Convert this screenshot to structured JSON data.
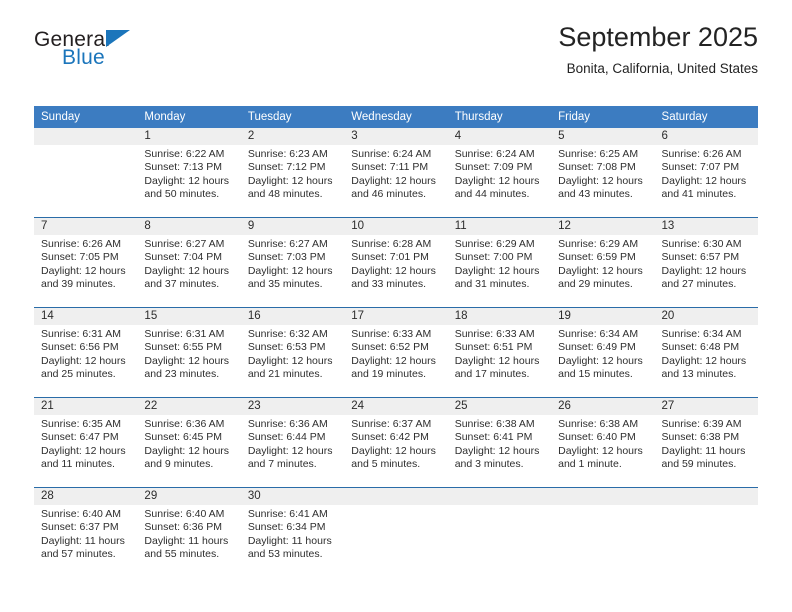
{
  "brand": {
    "name_top": "General",
    "name_bottom": "Blue",
    "accent_color": "#1b75bb",
    "triangle_icon": "brand-triangle-icon"
  },
  "header": {
    "title": "September 2025",
    "subtitle": "Bonita, California, United States"
  },
  "calendar": {
    "header_bg": "#3c7cc1",
    "header_text_color": "#ffffff",
    "daynum_bg": "#efefef",
    "row_divider_color": "#2a6ca8",
    "weekday_headers": [
      "Sunday",
      "Monday",
      "Tuesday",
      "Wednesday",
      "Thursday",
      "Friday",
      "Saturday"
    ],
    "weeks": [
      [
        {
          "day": "",
          "sunrise": "",
          "sunset": "",
          "daylight": "",
          "empty": true
        },
        {
          "day": "1",
          "sunrise": "Sunrise: 6:22 AM",
          "sunset": "Sunset: 7:13 PM",
          "daylight": "Daylight: 12 hours and 50 minutes."
        },
        {
          "day": "2",
          "sunrise": "Sunrise: 6:23 AM",
          "sunset": "Sunset: 7:12 PM",
          "daylight": "Daylight: 12 hours and 48 minutes."
        },
        {
          "day": "3",
          "sunrise": "Sunrise: 6:24 AM",
          "sunset": "Sunset: 7:11 PM",
          "daylight": "Daylight: 12 hours and 46 minutes."
        },
        {
          "day": "4",
          "sunrise": "Sunrise: 6:24 AM",
          "sunset": "Sunset: 7:09 PM",
          "daylight": "Daylight: 12 hours and 44 minutes."
        },
        {
          "day": "5",
          "sunrise": "Sunrise: 6:25 AM",
          "sunset": "Sunset: 7:08 PM",
          "daylight": "Daylight: 12 hours and 43 minutes."
        },
        {
          "day": "6",
          "sunrise": "Sunrise: 6:26 AM",
          "sunset": "Sunset: 7:07 PM",
          "daylight": "Daylight: 12 hours and 41 minutes."
        }
      ],
      [
        {
          "day": "7",
          "sunrise": "Sunrise: 6:26 AM",
          "sunset": "Sunset: 7:05 PM",
          "daylight": "Daylight: 12 hours and 39 minutes."
        },
        {
          "day": "8",
          "sunrise": "Sunrise: 6:27 AM",
          "sunset": "Sunset: 7:04 PM",
          "daylight": "Daylight: 12 hours and 37 minutes."
        },
        {
          "day": "9",
          "sunrise": "Sunrise: 6:27 AM",
          "sunset": "Sunset: 7:03 PM",
          "daylight": "Daylight: 12 hours and 35 minutes."
        },
        {
          "day": "10",
          "sunrise": "Sunrise: 6:28 AM",
          "sunset": "Sunset: 7:01 PM",
          "daylight": "Daylight: 12 hours and 33 minutes."
        },
        {
          "day": "11",
          "sunrise": "Sunrise: 6:29 AM",
          "sunset": "Sunset: 7:00 PM",
          "daylight": "Daylight: 12 hours and 31 minutes."
        },
        {
          "day": "12",
          "sunrise": "Sunrise: 6:29 AM",
          "sunset": "Sunset: 6:59 PM",
          "daylight": "Daylight: 12 hours and 29 minutes."
        },
        {
          "day": "13",
          "sunrise": "Sunrise: 6:30 AM",
          "sunset": "Sunset: 6:57 PM",
          "daylight": "Daylight: 12 hours and 27 minutes."
        }
      ],
      [
        {
          "day": "14",
          "sunrise": "Sunrise: 6:31 AM",
          "sunset": "Sunset: 6:56 PM",
          "daylight": "Daylight: 12 hours and 25 minutes."
        },
        {
          "day": "15",
          "sunrise": "Sunrise: 6:31 AM",
          "sunset": "Sunset: 6:55 PM",
          "daylight": "Daylight: 12 hours and 23 minutes."
        },
        {
          "day": "16",
          "sunrise": "Sunrise: 6:32 AM",
          "sunset": "Sunset: 6:53 PM",
          "daylight": "Daylight: 12 hours and 21 minutes."
        },
        {
          "day": "17",
          "sunrise": "Sunrise: 6:33 AM",
          "sunset": "Sunset: 6:52 PM",
          "daylight": "Daylight: 12 hours and 19 minutes."
        },
        {
          "day": "18",
          "sunrise": "Sunrise: 6:33 AM",
          "sunset": "Sunset: 6:51 PM",
          "daylight": "Daylight: 12 hours and 17 minutes."
        },
        {
          "day": "19",
          "sunrise": "Sunrise: 6:34 AM",
          "sunset": "Sunset: 6:49 PM",
          "daylight": "Daylight: 12 hours and 15 minutes."
        },
        {
          "day": "20",
          "sunrise": "Sunrise: 6:34 AM",
          "sunset": "Sunset: 6:48 PM",
          "daylight": "Daylight: 12 hours and 13 minutes."
        }
      ],
      [
        {
          "day": "21",
          "sunrise": "Sunrise: 6:35 AM",
          "sunset": "Sunset: 6:47 PM",
          "daylight": "Daylight: 12 hours and 11 minutes."
        },
        {
          "day": "22",
          "sunrise": "Sunrise: 6:36 AM",
          "sunset": "Sunset: 6:45 PM",
          "daylight": "Daylight: 12 hours and 9 minutes."
        },
        {
          "day": "23",
          "sunrise": "Sunrise: 6:36 AM",
          "sunset": "Sunset: 6:44 PM",
          "daylight": "Daylight: 12 hours and 7 minutes."
        },
        {
          "day": "24",
          "sunrise": "Sunrise: 6:37 AM",
          "sunset": "Sunset: 6:42 PM",
          "daylight": "Daylight: 12 hours and 5 minutes."
        },
        {
          "day": "25",
          "sunrise": "Sunrise: 6:38 AM",
          "sunset": "Sunset: 6:41 PM",
          "daylight": "Daylight: 12 hours and 3 minutes."
        },
        {
          "day": "26",
          "sunrise": "Sunrise: 6:38 AM",
          "sunset": "Sunset: 6:40 PM",
          "daylight": "Daylight: 12 hours and 1 minute."
        },
        {
          "day": "27",
          "sunrise": "Sunrise: 6:39 AM",
          "sunset": "Sunset: 6:38 PM",
          "daylight": "Daylight: 11 hours and 59 minutes."
        }
      ],
      [
        {
          "day": "28",
          "sunrise": "Sunrise: 6:40 AM",
          "sunset": "Sunset: 6:37 PM",
          "daylight": "Daylight: 11 hours and 57 minutes."
        },
        {
          "day": "29",
          "sunrise": "Sunrise: 6:40 AM",
          "sunset": "Sunset: 6:36 PM",
          "daylight": "Daylight: 11 hours and 55 minutes."
        },
        {
          "day": "30",
          "sunrise": "Sunrise: 6:41 AM",
          "sunset": "Sunset: 6:34 PM",
          "daylight": "Daylight: 11 hours and 53 minutes."
        },
        {
          "day": "",
          "sunrise": "",
          "sunset": "",
          "daylight": "",
          "empty": true
        },
        {
          "day": "",
          "sunrise": "",
          "sunset": "",
          "daylight": "",
          "empty": true
        },
        {
          "day": "",
          "sunrise": "",
          "sunset": "",
          "daylight": "",
          "empty": true
        },
        {
          "day": "",
          "sunrise": "",
          "sunset": "",
          "daylight": "",
          "empty": true
        }
      ]
    ]
  }
}
